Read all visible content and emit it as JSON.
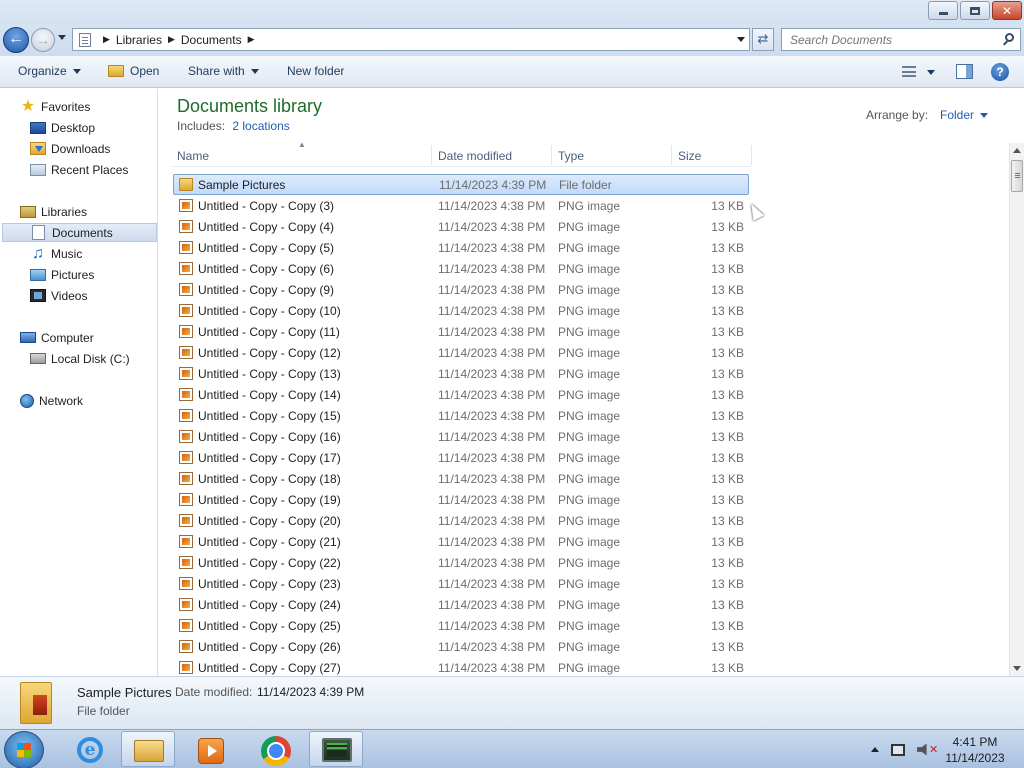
{
  "window": {
    "buttons": {
      "minimize": "minimize",
      "maximize": "maximize",
      "close": "✕"
    }
  },
  "address": {
    "breadcrumbs": [
      "Libraries",
      "Documents"
    ],
    "search_placeholder": "Search Documents"
  },
  "toolbar": {
    "organize": "Organize",
    "open": "Open",
    "share_with": "Share with",
    "new_folder": "New folder"
  },
  "nav": {
    "favorites": "Favorites",
    "desktop": "Desktop",
    "downloads": "Downloads",
    "recent_places": "Recent Places",
    "libraries": "Libraries",
    "documents": "Documents",
    "music": "Music",
    "pictures": "Pictures",
    "videos": "Videos",
    "computer": "Computer",
    "local_disk": "Local Disk (C:)",
    "network": "Network"
  },
  "library": {
    "title": "Documents library",
    "includes_label": "Includes:",
    "includes_link": "2 locations",
    "arrange_label": "Arrange by:",
    "arrange_value": "Folder"
  },
  "columns": {
    "name": "Name",
    "date": "Date modified",
    "type": "Type",
    "size": "Size"
  },
  "files": [
    {
      "name": "Sample Pictures",
      "date": "11/14/2023 4:39 PM",
      "type": "File folder",
      "size": "",
      "icon": "folder-icon"
    },
    {
      "name": "Untitled - Copy - Copy (3)",
      "date": "11/14/2023 4:38 PM",
      "type": "PNG image",
      "size": "13 KB",
      "icon": "png-icon"
    },
    {
      "name": "Untitled - Copy - Copy (4)",
      "date": "11/14/2023 4:38 PM",
      "type": "PNG image",
      "size": "13 KB",
      "icon": "png-icon"
    },
    {
      "name": "Untitled - Copy - Copy (5)",
      "date": "11/14/2023 4:38 PM",
      "type": "PNG image",
      "size": "13 KB",
      "icon": "png-icon"
    },
    {
      "name": "Untitled - Copy - Copy (6)",
      "date": "11/14/2023 4:38 PM",
      "type": "PNG image",
      "size": "13 KB",
      "icon": "png-icon"
    },
    {
      "name": "Untitled - Copy - Copy (9)",
      "date": "11/14/2023 4:38 PM",
      "type": "PNG image",
      "size": "13 KB",
      "icon": "png-icon"
    },
    {
      "name": "Untitled - Copy - Copy (10)",
      "date": "11/14/2023 4:38 PM",
      "type": "PNG image",
      "size": "13 KB",
      "icon": "png-icon"
    },
    {
      "name": "Untitled - Copy - Copy (11)",
      "date": "11/14/2023 4:38 PM",
      "type": "PNG image",
      "size": "13 KB",
      "icon": "png-icon"
    },
    {
      "name": "Untitled - Copy - Copy (12)",
      "date": "11/14/2023 4:38 PM",
      "type": "PNG image",
      "size": "13 KB",
      "icon": "png-icon"
    },
    {
      "name": "Untitled - Copy - Copy (13)",
      "date": "11/14/2023 4:38 PM",
      "type": "PNG image",
      "size": "13 KB",
      "icon": "png-icon"
    },
    {
      "name": "Untitled - Copy - Copy (14)",
      "date": "11/14/2023 4:38 PM",
      "type": "PNG image",
      "size": "13 KB",
      "icon": "png-icon"
    },
    {
      "name": "Untitled - Copy - Copy (15)",
      "date": "11/14/2023 4:38 PM",
      "type": "PNG image",
      "size": "13 KB",
      "icon": "png-icon"
    },
    {
      "name": "Untitled - Copy - Copy (16)",
      "date": "11/14/2023 4:38 PM",
      "type": "PNG image",
      "size": "13 KB",
      "icon": "png-icon"
    },
    {
      "name": "Untitled - Copy - Copy (17)",
      "date": "11/14/2023 4:38 PM",
      "type": "PNG image",
      "size": "13 KB",
      "icon": "png-icon"
    },
    {
      "name": "Untitled - Copy - Copy (18)",
      "date": "11/14/2023 4:38 PM",
      "type": "PNG image",
      "size": "13 KB",
      "icon": "png-icon"
    },
    {
      "name": "Untitled - Copy - Copy (19)",
      "date": "11/14/2023 4:38 PM",
      "type": "PNG image",
      "size": "13 KB",
      "icon": "png-icon"
    },
    {
      "name": "Untitled - Copy - Copy (20)",
      "date": "11/14/2023 4:38 PM",
      "type": "PNG image",
      "size": "13 KB",
      "icon": "png-icon"
    },
    {
      "name": "Untitled - Copy - Copy (21)",
      "date": "11/14/2023 4:38 PM",
      "type": "PNG image",
      "size": "13 KB",
      "icon": "png-icon"
    },
    {
      "name": "Untitled - Copy - Copy (22)",
      "date": "11/14/2023 4:38 PM",
      "type": "PNG image",
      "size": "13 KB",
      "icon": "png-icon"
    },
    {
      "name": "Untitled - Copy - Copy (23)",
      "date": "11/14/2023 4:38 PM",
      "type": "PNG image",
      "size": "13 KB",
      "icon": "png-icon"
    },
    {
      "name": "Untitled - Copy - Copy (24)",
      "date": "11/14/2023 4:38 PM",
      "type": "PNG image",
      "size": "13 KB",
      "icon": "png-icon"
    },
    {
      "name": "Untitled - Copy - Copy (25)",
      "date": "11/14/2023 4:38 PM",
      "type": "PNG image",
      "size": "13 KB",
      "icon": "png-icon"
    },
    {
      "name": "Untitled - Copy - Copy (26)",
      "date": "11/14/2023 4:38 PM",
      "type": "PNG image",
      "size": "13 KB",
      "icon": "png-icon"
    },
    {
      "name": "Untitled - Copy - Copy (27)",
      "date": "11/14/2023 4:38 PM",
      "type": "PNG image",
      "size": "13 KB",
      "icon": "png-icon"
    }
  ],
  "details": {
    "name": "Sample Pictures",
    "date_label": "Date modified:",
    "date_value": "11/14/2023 4:39 PM",
    "type": "File folder"
  },
  "taskbar": {
    "apps": [
      "internet-explorer",
      "windows-explorer",
      "media-player",
      "chrome",
      "terminal"
    ],
    "clock_time": "4:41 PM",
    "clock_date": "11/14/2023"
  }
}
